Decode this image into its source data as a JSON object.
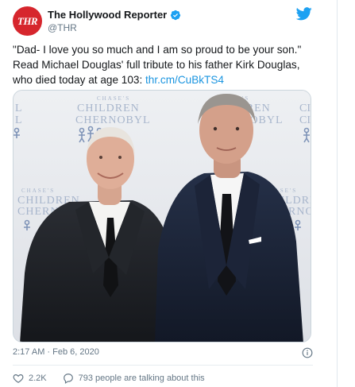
{
  "account": {
    "avatar_text": "THR",
    "display_name": "The Hollywood Reporter",
    "handle": "@THR"
  },
  "tweet": {
    "text": "\"Dad- I love you so much and I am so proud to be your son.\" Read Michael Douglas' full tribute to his father Kirk Douglas, who died today at age 103: ",
    "link": "thr.cm/CuBkTS4"
  },
  "media": {
    "backdrop_banner_lines": [
      "CHASE'S",
      "CHILDREN",
      "of",
      "CHERNOBYL"
    ]
  },
  "meta": {
    "timestamp": "2:17 AM · Feb 6, 2020"
  },
  "actions": {
    "likes": "2.2K",
    "conversation": "793 people are talking about this"
  },
  "colors": {
    "brand_red": "#d6262d",
    "twitter_blue": "#1da1f2",
    "link_blue": "#1b95e0",
    "muted_gray": "#657786"
  }
}
